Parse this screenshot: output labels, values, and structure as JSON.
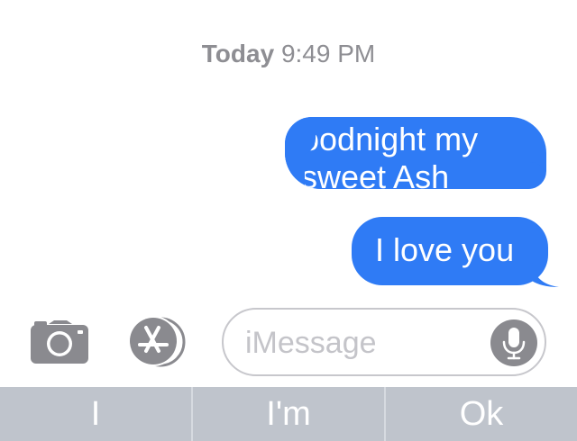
{
  "timestamp": {
    "day": "Today",
    "time": "9:49 PM"
  },
  "messages": [
    {
      "text": "oodnight my\nsweet Ash",
      "direction": "outgoing",
      "redacted": true
    },
    {
      "text": "I love you",
      "direction": "outgoing",
      "redacted": false
    }
  ],
  "input": {
    "placeholder": "iMessage",
    "value": ""
  },
  "icons": {
    "camera": "camera-icon",
    "apps": "app-store-icon",
    "mic": "microphone-icon"
  },
  "suggestions": [
    "I",
    "I'm",
    "Ok"
  ],
  "colors": {
    "bubble": "#2f7bf5",
    "icon_gray": "#8a8a8f",
    "suggestion_bar": "#bfc4cc",
    "timestamp": "#8e8e93"
  }
}
